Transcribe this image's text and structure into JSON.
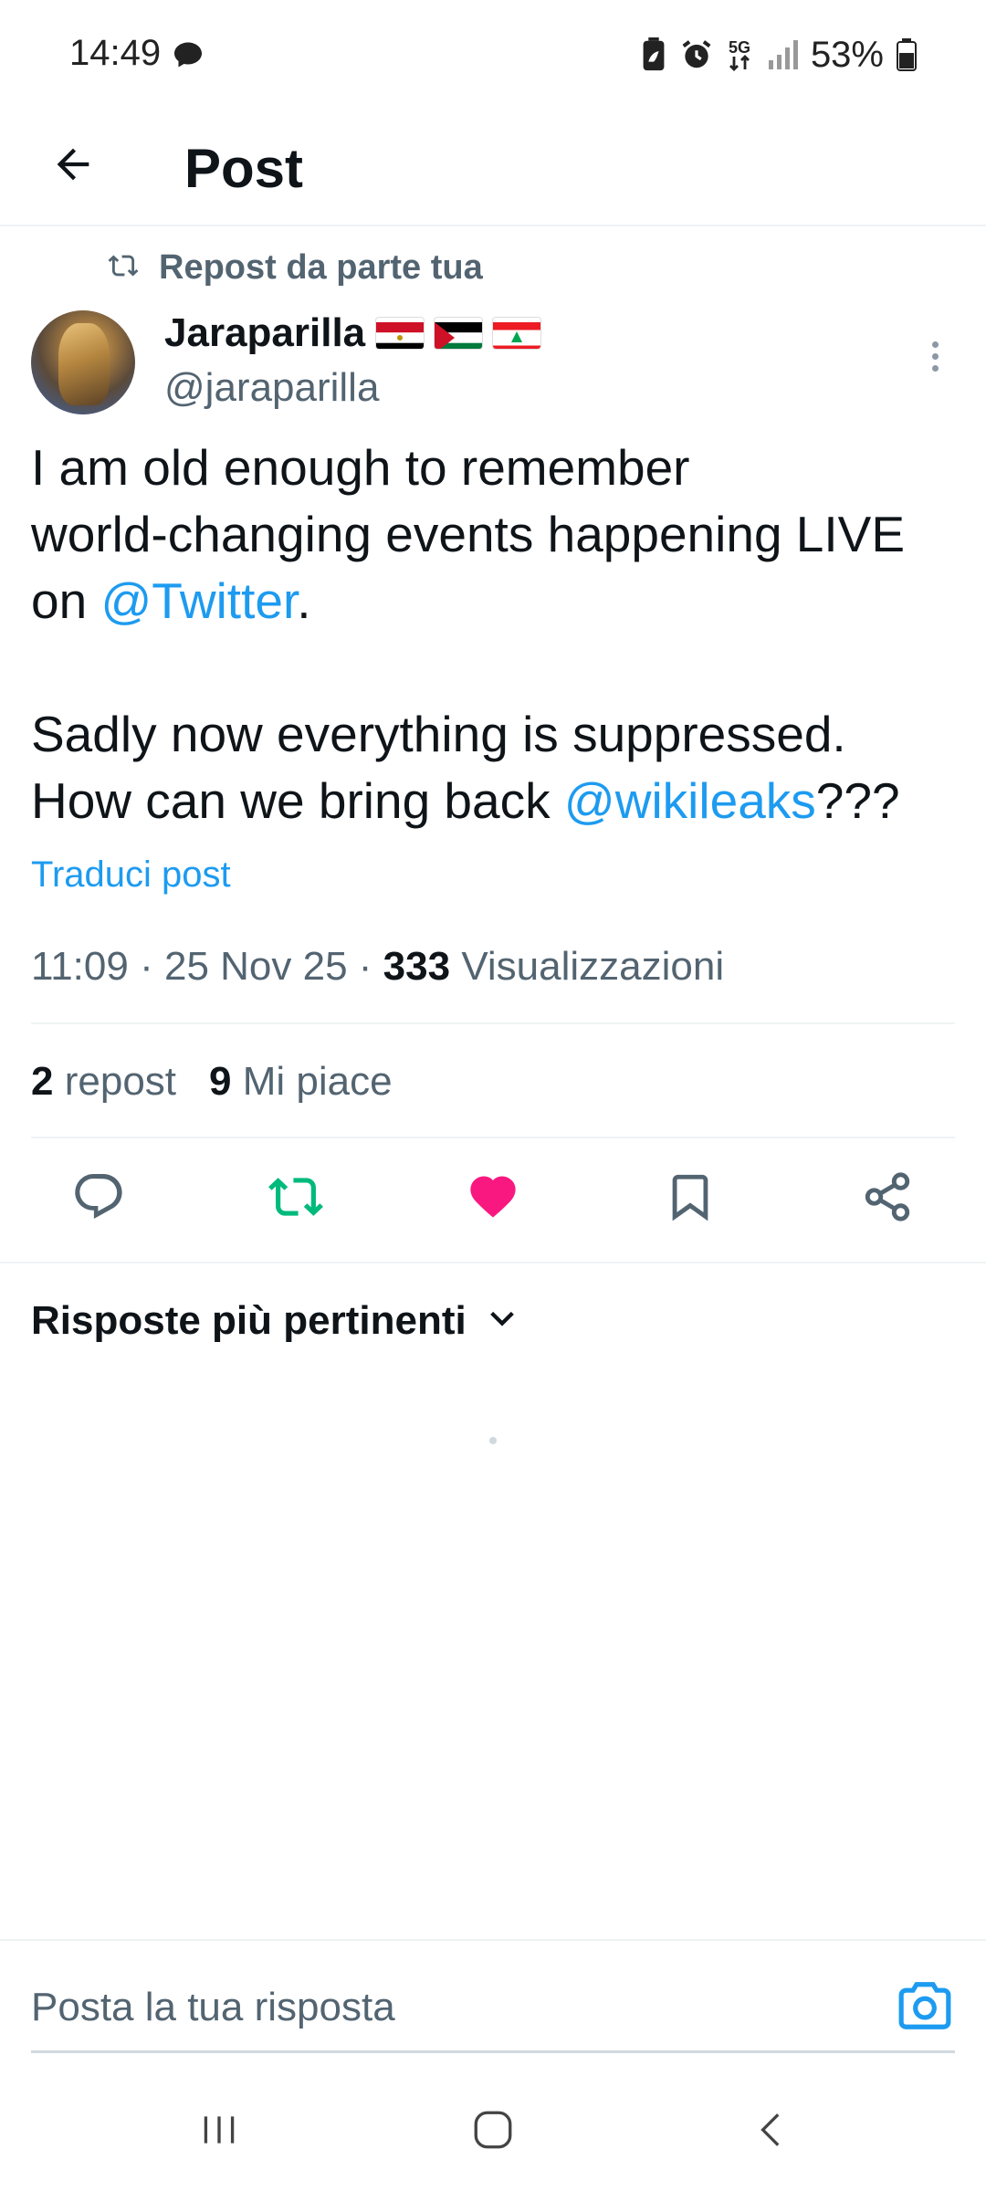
{
  "status_bar": {
    "time": "14:49",
    "battery": "53%",
    "network": "5G",
    "icons": [
      "chat-bubble-icon",
      "battery-saver-icon",
      "alarm-icon",
      "5g-icon",
      "signal-icon",
      "battery-icon"
    ]
  },
  "header": {
    "title": "Post",
    "back_icon": "arrow-left-icon"
  },
  "repost_context": {
    "label": "Repost da parte tua",
    "icon": "repost-icon"
  },
  "author": {
    "name": "Jaraparilla",
    "handle": "@jaraparilla",
    "flags": [
      "egypt-flag",
      "palestine-flag",
      "lebanon-flag"
    ]
  },
  "post": {
    "line1": "I am old enough to remember",
    "line2": "world-changing events happening LIVE",
    "line3_prefix": "on ",
    "mention1": "@Twitter",
    "line3_suffix": ".",
    "line4": "Sadly now everything is suppressed.",
    "line5_prefix": "How can we bring back ",
    "mention2": "@wikileaks",
    "line5_suffix": "???",
    "translate_label": "Traduci post",
    "time": "11:09",
    "date": "25 Nov 25",
    "separator": "·",
    "views_count": "333",
    "views_label": "Visualizzazioni"
  },
  "stats": {
    "reposts_count": "2",
    "reposts_label": "repost",
    "likes_count": "9",
    "likes_label": "Mi piace"
  },
  "actions": [
    "reply-icon",
    "repost-icon",
    "like-icon",
    "bookmark-icon",
    "share-icon"
  ],
  "colors": {
    "accent": "#1d9bf0",
    "repost_active": "#00ba7c",
    "like_active": "#f91880",
    "text_primary": "#0f1419",
    "text_secondary": "#536471"
  },
  "replies": {
    "sort_label": "Risposte più pertinenti"
  },
  "composer": {
    "placeholder": "Posta la tua risposta"
  },
  "nav_bar": [
    "recent-apps-icon",
    "home-icon",
    "back-icon"
  ]
}
